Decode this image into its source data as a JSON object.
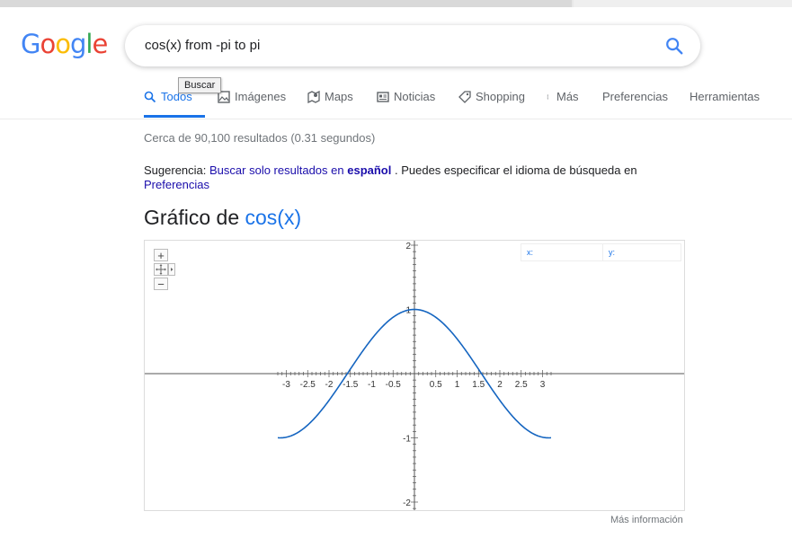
{
  "search": {
    "query": "cos(x) from -pi to pi"
  },
  "logo": {
    "letters": [
      "G",
      "o",
      "o",
      "g",
      "l",
      "e"
    ],
    "colors": [
      "#4285F4",
      "#EA4335",
      "#FBBC05",
      "#4285F4",
      "#34A853",
      "#EA4335"
    ]
  },
  "tabs": [
    {
      "label": "Todos",
      "icon": "search-icon"
    },
    {
      "label": "Imágenes",
      "icon": "image-icon"
    },
    {
      "label": "Maps",
      "icon": "map-icon"
    },
    {
      "label": "Noticias",
      "icon": "news-icon"
    },
    {
      "label": "Shopping",
      "icon": "tag-icon"
    },
    {
      "label": "Más",
      "icon": "more-vert-icon"
    },
    {
      "label": "Preferencias"
    },
    {
      "label": "Herramientas"
    }
  ],
  "tooltip": "Buscar",
  "stats": "Cerca de 90,100 resultados (0.31 segundos)",
  "suggestion": {
    "prefix": "Sugerencia:",
    "link": "Buscar solo resultados en",
    "lang": "español",
    "middle": ". Puedes especificar el idioma de búsqueda en",
    "prefs": "Preferencias"
  },
  "graph": {
    "title_prefix": "Gráfico de",
    "function": "cos(x)",
    "readout_x": "x:",
    "readout_y": "y:",
    "zoom_in": "+",
    "zoom_out": "−",
    "more_info": "Más información"
  },
  "colors": {
    "accent": "#1a73e8",
    "link": "#1a0dab",
    "curve": "#1565c0"
  },
  "chart_data": {
    "type": "line",
    "function": "cos(x)",
    "x": [
      -3.2,
      -3.0,
      -2.5,
      -2.0,
      -1.5,
      -1.0,
      -0.5,
      0,
      0.5,
      1.0,
      1.5,
      2.0,
      2.5,
      3.0,
      3.2
    ],
    "y": [
      -0.998,
      -0.99,
      -0.801,
      -0.416,
      0.071,
      0.54,
      0.878,
      1.0,
      0.878,
      0.54,
      0.071,
      -0.416,
      -0.801,
      -0.99,
      -0.998
    ],
    "xlim": [
      -3.15,
      3.15
    ],
    "ylim": [
      -2.1,
      2.1
    ],
    "x_ticks": [
      "-3",
      "-2.5",
      "-2",
      "-1.5",
      "-1",
      "-0.5",
      "0.5",
      "1",
      "1.5",
      "2",
      "2.5",
      "3"
    ],
    "y_ticks": [
      "2",
      "1",
      "-1",
      "-2"
    ],
    "grid": false
  }
}
